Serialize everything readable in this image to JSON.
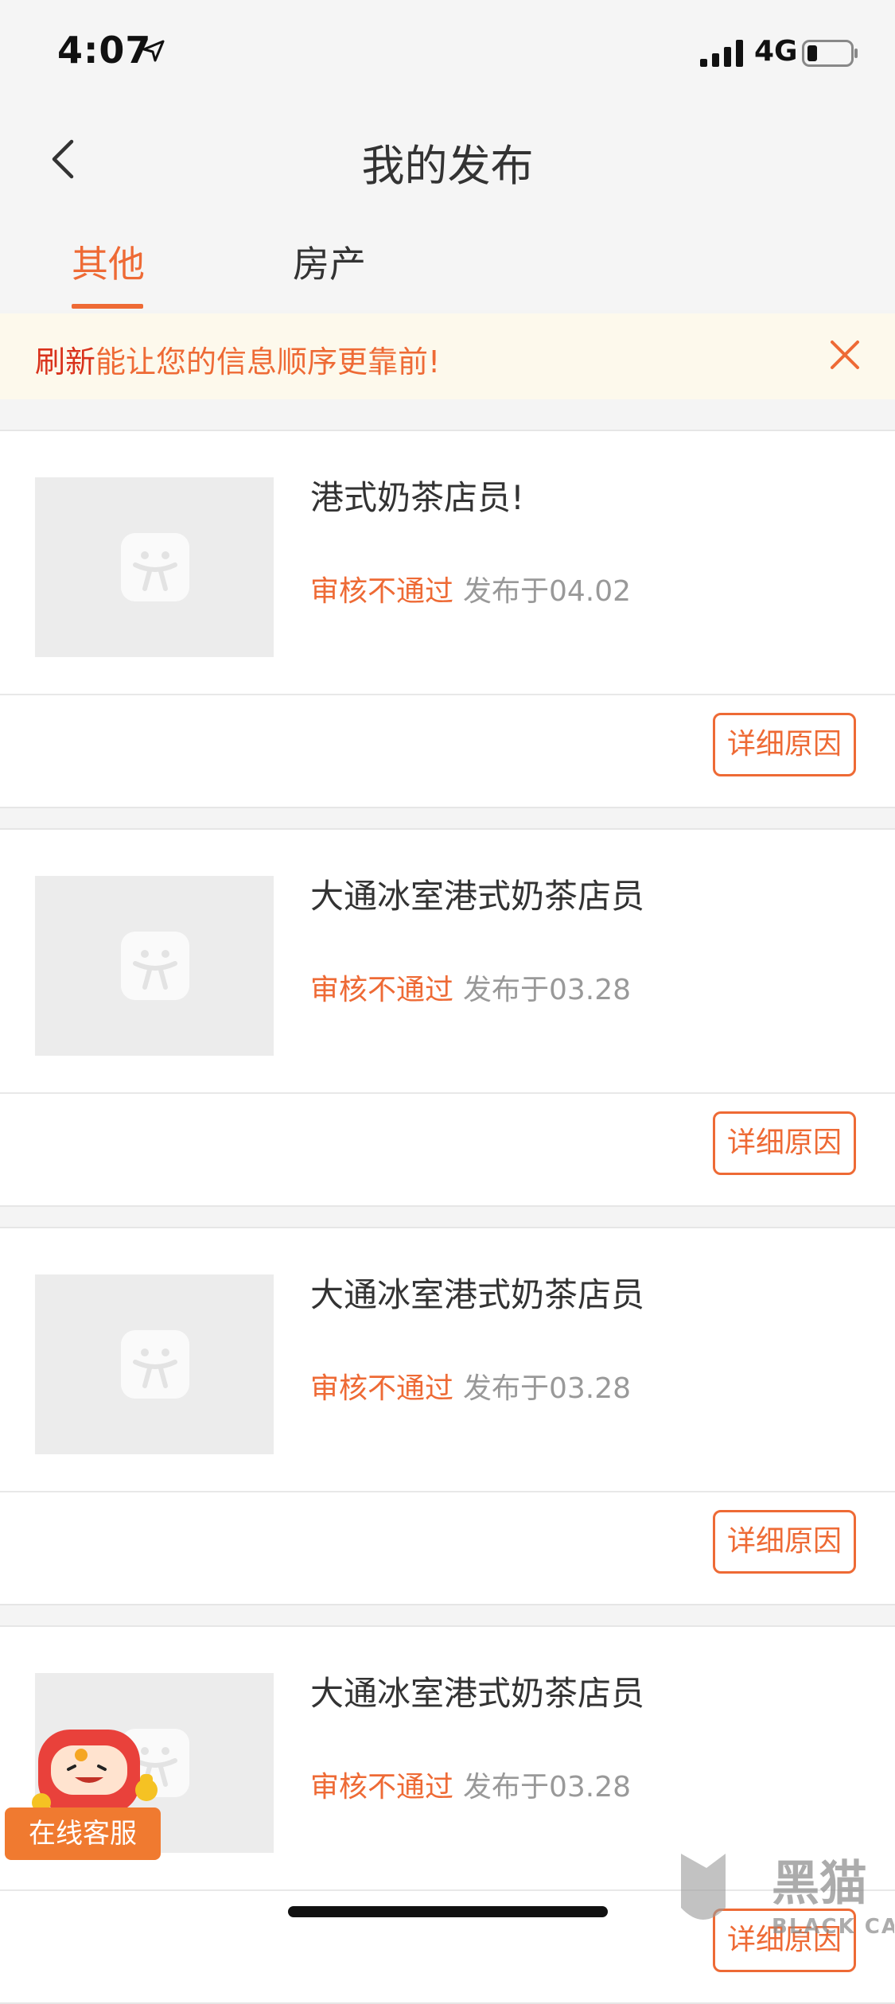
{
  "status_bar": {
    "time": "4:07",
    "network": "4G"
  },
  "nav": {
    "title": "我的发布"
  },
  "tabs": [
    {
      "label": "其他",
      "active": true
    },
    {
      "label": "房产",
      "active": false
    }
  ],
  "banner": {
    "highlight": "刷新",
    "text": "能让您的信息顺序更靠前!"
  },
  "posts": [
    {
      "title": "港式奶茶店员!",
      "status": "审核不通过",
      "date": "发布于04.02",
      "button": "详细原因"
    },
    {
      "title": "大通冰室港式奶茶店员",
      "status": "审核不通过",
      "date": "发布于03.28",
      "button": "详细原因"
    },
    {
      "title": "大通冰室港式奶茶店员",
      "status": "审核不通过",
      "date": "发布于03.28",
      "button": "详细原因"
    },
    {
      "title": "大通冰室港式奶茶店员",
      "status": "审核不通过",
      "date": "发布于03.28",
      "button": "详细原因"
    }
  ],
  "customer_service": {
    "label": "在线客服"
  },
  "watermark": {
    "text_cn": "黑猫",
    "text_en": "BLACK CAT"
  },
  "colors": {
    "accent": "#ee6a35",
    "banner_bg": "#fdf9ec",
    "refresh_red": "#d9321b"
  }
}
